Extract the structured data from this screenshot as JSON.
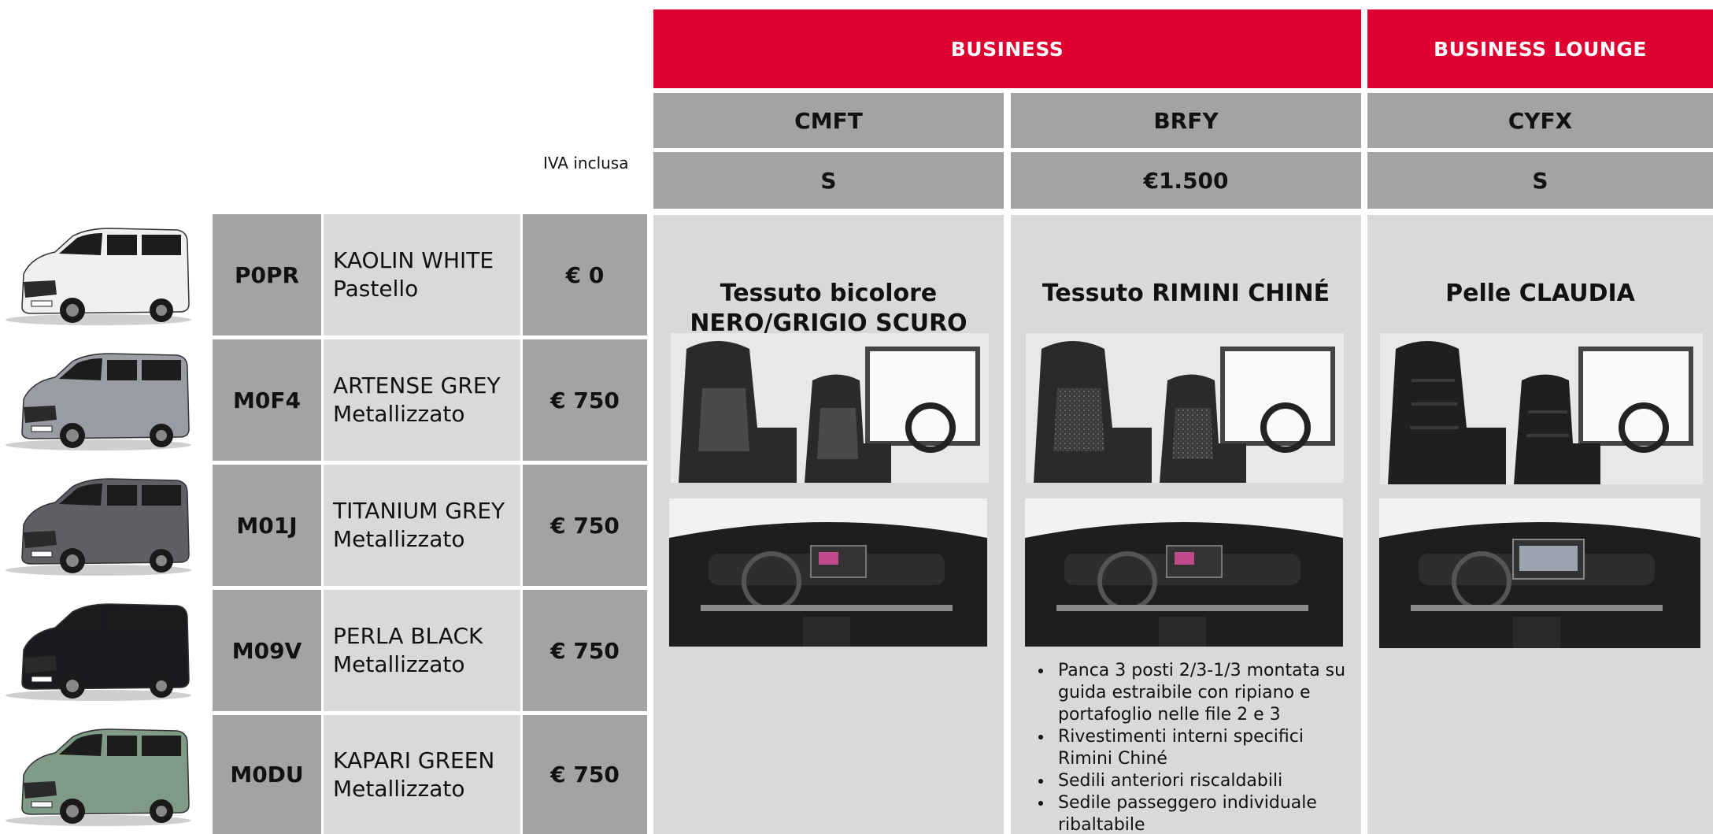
{
  "header": {
    "group1": "BUSINESS",
    "group2": "BUSINESS LOUNGE",
    "iva_note": "IVA inclusa"
  },
  "trims": [
    {
      "code": "CMFT",
      "price": "S",
      "title_line1": "Tessuto bicolore",
      "title_line2": "NERO/GRIGIO SCURO",
      "seat_color": "#2a2a2a",
      "seat_pattern": "two-tone-fabric"
    },
    {
      "code": "BRFY",
      "price": "€1.500",
      "title_line1": "Tessuto RIMINI CHINÉ",
      "title_line2": "",
      "seat_color": "#2e2e2e",
      "seat_pattern": "chine-fabric"
    },
    {
      "code": "CYFX",
      "price": "S",
      "title_line1": "Pelle CLAUDIA",
      "title_line2": "",
      "seat_color": "#1f1f1f",
      "seat_pattern": "leather"
    }
  ],
  "brfy_features": [
    "Panca 3 posti 2/3-1/3 montata su guida estraibile con ripiano e portafoglio nelle file 2 e 3",
    "Rivestimenti interni specifici Rimini Chiné",
    "Sedili anteriori riscaldabili",
    "Sedile passeggero individuale ribaltabile"
  ],
  "colors": [
    {
      "code": "P0PR",
      "name": "KAOLIN WHITE",
      "finish": "Pastello",
      "price": "€ 0",
      "van_color": "#eef0f2"
    },
    {
      "code": "M0F4",
      "name": "ARTENSE GREY",
      "finish": "Metallizzato",
      "price": "€ 750",
      "van_color": "#9a9ca3"
    },
    {
      "code": "M01J",
      "name": "TITANIUM GREY",
      "finish": "Metallizzato",
      "price": "€ 750",
      "van_color": "#5e6066"
    },
    {
      "code": "M09V",
      "name": "PERLA BLACK",
      "finish": "Metallizzato",
      "price": "€ 750",
      "van_color": "#1a1b1e"
    },
    {
      "code": "M0DU",
      "name": "KAPARI GREEN",
      "finish": "Metallizzato",
      "price": "€ 750",
      "van_color": "#7f9a85"
    }
  ],
  "accent": {
    "red": "#dd0031",
    "dark_grey": "#a3a3a3",
    "light_grey": "#d9d9d9"
  }
}
